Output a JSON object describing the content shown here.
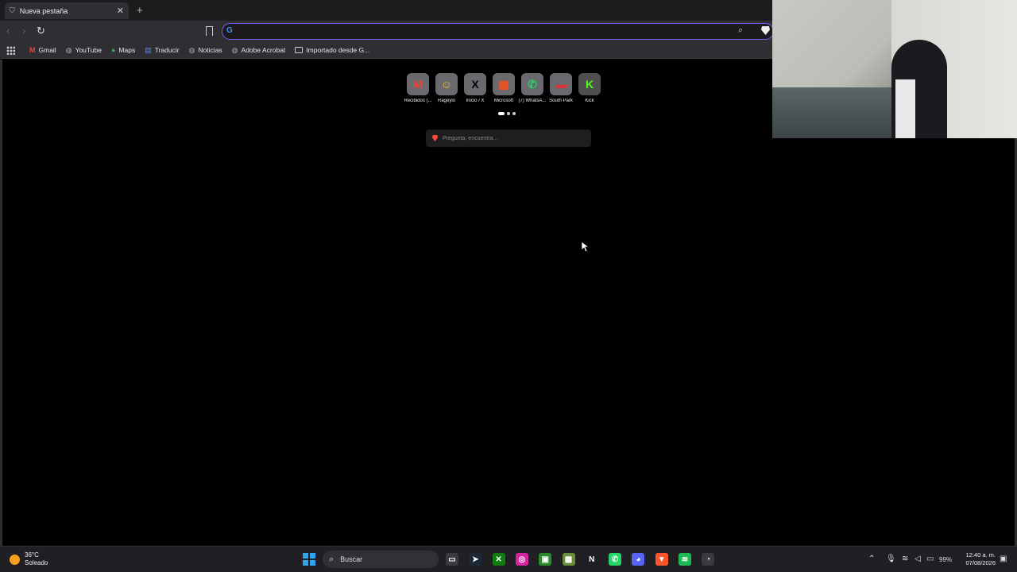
{
  "browser": {
    "tab": {
      "title": "Nueva pestaña",
      "icon": "shield-icon"
    },
    "new_tab_label": "+",
    "omnibox": {
      "value": "",
      "placeholder": ""
    },
    "bookmarks": [
      {
        "label": "Gmail",
        "icon": "gmail-icon"
      },
      {
        "label": "YouTube",
        "icon": "globe-icon"
      },
      {
        "label": "Maps",
        "icon": "maps-icon"
      },
      {
        "label": "Traducir",
        "icon": "translate-icon"
      },
      {
        "label": "Noticias",
        "icon": "globe-icon"
      },
      {
        "label": "Adobe Acrobat",
        "icon": "globe-icon"
      },
      {
        "label": "Importado desde G...",
        "icon": "folder-icon"
      }
    ]
  },
  "newtab": {
    "tiles": [
      {
        "label": "Recibidos (...",
        "glyph": "M",
        "bg": "#6a6a6e",
        "color": "#ea4335"
      },
      {
        "label": "Rageylo",
        "glyph": "☺",
        "bg": "#6a6a6e",
        "color": "#f2c34a"
      },
      {
        "label": "Inicio / X",
        "glyph": "X",
        "bg": "#6a6a6e",
        "color": "#000000"
      },
      {
        "label": "Microsoft",
        "glyph": "▦",
        "bg": "#6a6a6e",
        "color": "#f25022"
      },
      {
        "label": "(7) WhatsA...",
        "glyph": "✆",
        "bg": "#6a6a6e",
        "color": "#25d366"
      },
      {
        "label": "South Park",
        "glyph": "▬",
        "bg": "#6a6a6e",
        "color": "#d9343a"
      },
      {
        "label": "Kick",
        "glyph": "K",
        "bg": "#4f4f52",
        "color": "#53fc18"
      }
    ],
    "search_placeholder": "Pregunta, encuentra..."
  },
  "taskbar": {
    "weather": {
      "temp": "36°C",
      "desc": "Soleado"
    },
    "search_label": "Buscar",
    "apps": [
      {
        "name": "file-explorer-icon",
        "glyph": "▭",
        "bg": "#3a3a3e"
      },
      {
        "name": "steam-icon",
        "glyph": "➤",
        "bg": "#1b2838"
      },
      {
        "name": "xbox-icon",
        "glyph": "✕",
        "bg": "#107c10"
      },
      {
        "name": "instagram-icon",
        "glyph": "◎",
        "bg": "#d6249f"
      },
      {
        "name": "xbox-app-icon",
        "glyph": "▣",
        "bg": "#2a8a2a"
      },
      {
        "name": "minecraft-icon",
        "glyph": "▩",
        "bg": "#6b8e3a"
      },
      {
        "name": "netflix-icon",
        "glyph": "N",
        "bg": "#202024"
      },
      {
        "name": "whatsapp-icon",
        "glyph": "✆",
        "bg": "#25d366"
      },
      {
        "name": "discord-icon",
        "glyph": "◕",
        "bg": "#5865f2"
      },
      {
        "name": "brave-icon",
        "glyph": "▼",
        "bg": "#fb542b"
      },
      {
        "name": "spotify-icon",
        "glyph": "≋",
        "bg": "#1db954"
      },
      {
        "name": "chrome-icon",
        "glyph": "◔",
        "bg": "#3a3a3e"
      }
    ],
    "battery": "99%",
    "clock": {
      "time": "12:40 a. m.",
      "date": "07/08/2026"
    }
  },
  "colors": {
    "accent": "#7b5cf5",
    "chrome_bg": "#2f2f33",
    "tabbar_bg": "#1c1c1f"
  }
}
